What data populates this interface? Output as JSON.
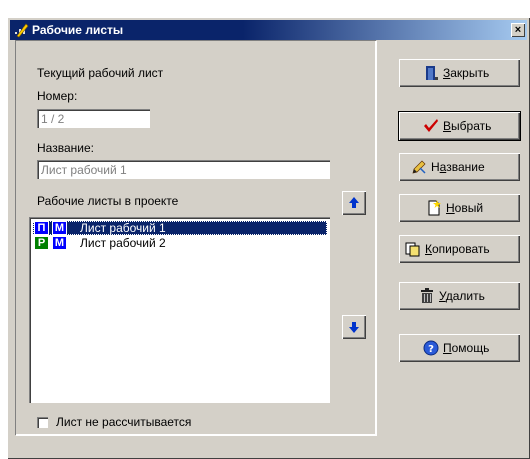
{
  "window": {
    "title": "Рабочие листы",
    "close_glyph": "×"
  },
  "current": {
    "group_label": "Текущий рабочий лист",
    "number_label": "Номер:",
    "number_value": "1 / 2",
    "name_label": "Название:",
    "name_value": "Лист рабочий 1"
  },
  "project": {
    "list_label": "Рабочие листы в проекте",
    "sheets": [
      {
        "badge1": "П",
        "badge1_color": "#0000ff",
        "badge2": "М",
        "badge2_color": "#0000ff",
        "name": "Лист рабочий 1",
        "selected": true
      },
      {
        "badge1": "Р",
        "badge1_color": "#008000",
        "badge2": "М",
        "badge2_color": "#0000ff",
        "name": "Лист рабочий 2",
        "selected": false
      }
    ],
    "checkbox_label": "Лист не рассчитывается",
    "checkbox_checked": false
  },
  "buttons": {
    "close": {
      "mnemonic": "З",
      "rest": "акрыть",
      "icon": "door-icon"
    },
    "select": {
      "mnemonic": "В",
      "rest": "ыбрать",
      "icon": "checkmark-icon"
    },
    "rename": {
      "pre": "Н",
      "mnemonic": "а",
      "rest": "звание",
      "icon": "pencil-icon"
    },
    "new": {
      "mnemonic": "Н",
      "rest": "овый",
      "icon": "new-page-icon"
    },
    "copy": {
      "mnemonic": "К",
      "rest": "опировать",
      "icon": "copy-icon"
    },
    "delete": {
      "mnemonic": "У",
      "rest": "далить",
      "icon": "trash-icon"
    },
    "help": {
      "mnemonic": "П",
      "rest": "омощь",
      "icon": "help-icon"
    }
  },
  "colors": {
    "accent": "#0a246a",
    "face": "#d4d0c8",
    "arrow": "#0033cc",
    "check": "#cc0000"
  }
}
